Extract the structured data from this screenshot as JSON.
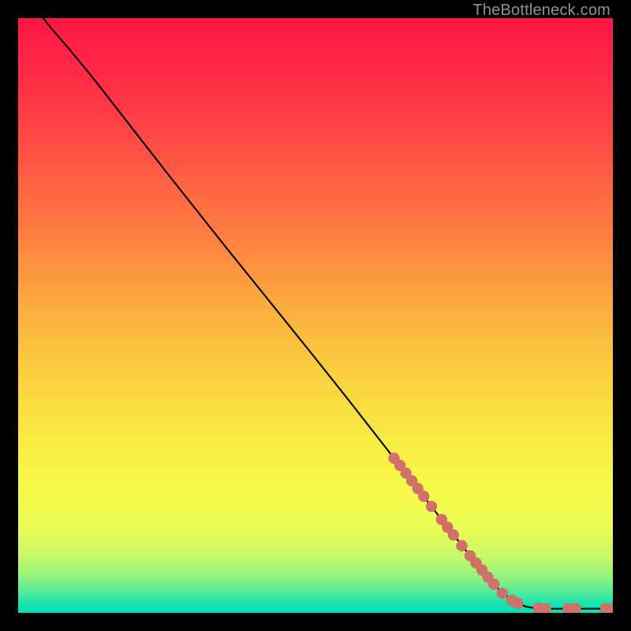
{
  "watermark": {
    "text": "TheBottleneck.com"
  },
  "colors": {
    "background": "#000000",
    "curve": "#000000",
    "marker": "#cf7069",
    "gradient_stops": [
      {
        "offset": 0.0,
        "color": "#ff1643"
      },
      {
        "offset": 0.12,
        "color": "#ff3146"
      },
      {
        "offset": 0.25,
        "color": "#ff5844"
      },
      {
        "offset": 0.38,
        "color": "#fe8441"
      },
      {
        "offset": 0.5,
        "color": "#fbb13f"
      },
      {
        "offset": 0.62,
        "color": "#f9d63e"
      },
      {
        "offset": 0.72,
        "color": "#f8ed44"
      },
      {
        "offset": 0.8,
        "color": "#f7fa4c"
      },
      {
        "offset": 0.86,
        "color": "#e9fb55"
      },
      {
        "offset": 0.905,
        "color": "#c6f967"
      },
      {
        "offset": 0.94,
        "color": "#92f37f"
      },
      {
        "offset": 0.965,
        "color": "#51ea99"
      },
      {
        "offset": 0.985,
        "color": "#18e2b0"
      },
      {
        "offset": 1.0,
        "color": "#03dfb8"
      }
    ]
  },
  "chart_data": {
    "type": "line",
    "title": "",
    "xlabel": "",
    "ylabel": "",
    "xlim": [
      0,
      100
    ],
    "ylim": [
      0,
      100
    ],
    "grid": false,
    "legend": false,
    "curve": {
      "comment": "x,y in percent of plot area; y=0 at top, y=100 at bottom",
      "points": [
        [
          4.2,
          0.0
        ],
        [
          6.0,
          2.2
        ],
        [
          9.0,
          5.7
        ],
        [
          13.0,
          10.6
        ],
        [
          18.0,
          17.0
        ],
        [
          25.0,
          26.0
        ],
        [
          35.0,
          38.6
        ],
        [
          45.0,
          51.0
        ],
        [
          55.0,
          63.5
        ],
        [
          65.0,
          76.3
        ],
        [
          73.0,
          86.6
        ],
        [
          80.0,
          95.2
        ],
        [
          84.0,
          98.3
        ],
        [
          87.0,
          99.2
        ],
        [
          92.0,
          99.3
        ],
        [
          96.0,
          99.3
        ],
        [
          100.0,
          99.3
        ]
      ]
    },
    "markers": {
      "radius_pct": 0.95,
      "points": [
        [
          63.2,
          74.0
        ],
        [
          64.2,
          75.2
        ],
        [
          65.2,
          76.5
        ],
        [
          66.2,
          77.8
        ],
        [
          67.2,
          79.1
        ],
        [
          68.2,
          80.4
        ],
        [
          69.5,
          82.1
        ],
        [
          71.2,
          84.3
        ],
        [
          72.2,
          85.6
        ],
        [
          73.2,
          86.9
        ],
        [
          74.6,
          88.7
        ],
        [
          76.0,
          90.4
        ],
        [
          77.0,
          91.6
        ],
        [
          78.0,
          92.8
        ],
        [
          79.0,
          94.0
        ],
        [
          80.0,
          95.2
        ],
        [
          81.4,
          96.7
        ],
        [
          83.0,
          97.9
        ],
        [
          84.0,
          98.4
        ],
        [
          87.5,
          99.2
        ],
        [
          88.7,
          99.3
        ],
        [
          92.5,
          99.3
        ],
        [
          93.7,
          99.3
        ],
        [
          98.8,
          99.3
        ],
        [
          100.0,
          99.3
        ]
      ]
    }
  }
}
